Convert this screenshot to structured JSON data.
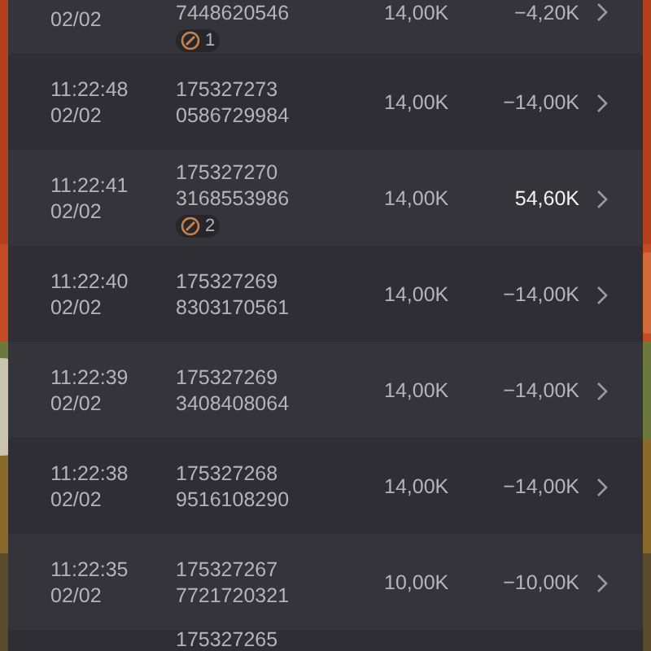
{
  "rows": [
    {
      "kind": "cuttop",
      "date": "02/02",
      "id_lines": [
        "7448620546"
      ],
      "badge": "1",
      "bet": "14,00K",
      "result": "−4,20K",
      "highlight": false
    },
    {
      "kind": "full",
      "time": "11:22:48",
      "date": "02/02",
      "id_lines": [
        "175327273",
        "0586729984"
      ],
      "bet": "14,00K",
      "result": "−14,00K",
      "highlight": false
    },
    {
      "kind": "full",
      "time": "11:22:41",
      "date": "02/02",
      "id_lines": [
        "175327270",
        "3168553986"
      ],
      "badge": "2",
      "bet": "14,00K",
      "result": "54,60K",
      "highlight": true
    },
    {
      "kind": "full",
      "time": "11:22:40",
      "date": "02/02",
      "id_lines": [
        "175327269",
        "8303170561"
      ],
      "bet": "14,00K",
      "result": "−14,00K",
      "highlight": false
    },
    {
      "kind": "full",
      "time": "11:22:39",
      "date": "02/02",
      "id_lines": [
        "175327269",
        "3408408064"
      ],
      "bet": "14,00K",
      "result": "−14,00K",
      "highlight": false
    },
    {
      "kind": "full",
      "time": "11:22:38",
      "date": "02/02",
      "id_lines": [
        "175327268",
        "9516108290"
      ],
      "bet": "14,00K",
      "result": "−14,00K",
      "highlight": false
    },
    {
      "kind": "full",
      "time": "11:22:35",
      "date": "02/02",
      "id_lines": [
        "175327267",
        "7721720321"
      ],
      "bet": "10,00K",
      "result": "−10,00K",
      "highlight": false
    },
    {
      "kind": "cutbottom",
      "id_lines": [
        "175327265"
      ]
    }
  ]
}
